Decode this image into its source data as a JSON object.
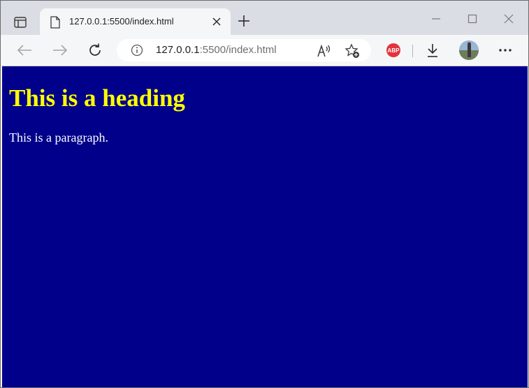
{
  "tab": {
    "title": "127.0.0.1:5500/index.html"
  },
  "address": {
    "host": "127.0.0.1",
    "rest": ":5500/index.html"
  },
  "extensions": {
    "adblock_label": "ABP"
  },
  "page": {
    "heading": "This is a heading",
    "paragraph": "This is a paragraph.",
    "background_color": "#00008b",
    "heading_color": "#ffff00",
    "paragraph_color": "#ffffff"
  },
  "icons": {
    "tab_actions": "tab-actions-icon",
    "favicon": "page-icon",
    "close": "close-icon",
    "new_tab": "plus-icon",
    "back": "back-arrow-icon",
    "forward": "forward-arrow-icon",
    "refresh": "refresh-icon",
    "info": "info-icon",
    "read_aloud": "read-aloud-icon",
    "favorites": "add-favorite-icon",
    "downloads": "download-icon",
    "menu": "more-dots-icon"
  }
}
